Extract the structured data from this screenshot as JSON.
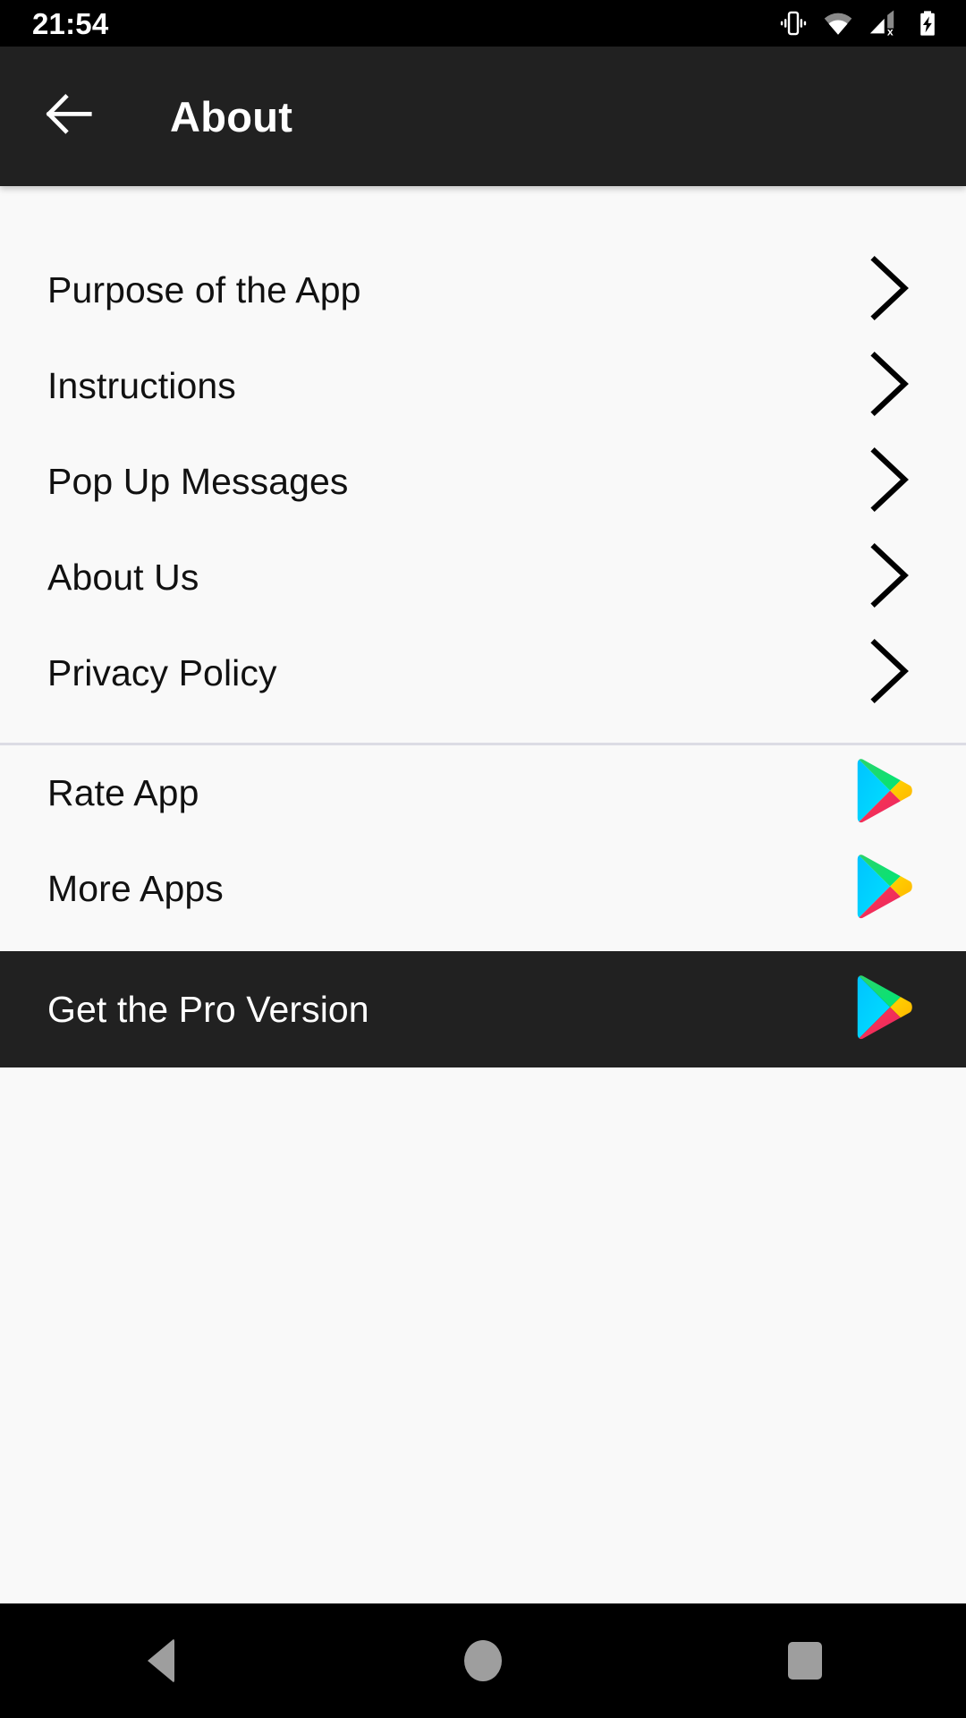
{
  "status_bar": {
    "time": "21:54",
    "icons": [
      {
        "name": "vibrate-icon",
        "label": "Vibrate mode"
      },
      {
        "name": "wifi-icon",
        "label": "Wi-Fi signal"
      },
      {
        "name": "cellular-off-icon",
        "label": "No cellular signal"
      },
      {
        "name": "battery-charging-icon",
        "label": "Battery charging"
      }
    ]
  },
  "app_bar": {
    "title": "About",
    "back_icon": "arrow-left-icon",
    "background": "#212121",
    "text_color": "#ffffff"
  },
  "menu": {
    "groups": [
      {
        "group_name": "info-links",
        "items": [
          {
            "label": "Purpose of the App",
            "icon": "chevron-right-icon",
            "style": "light"
          },
          {
            "label": "Instructions",
            "icon": "chevron-right-icon",
            "style": "light"
          },
          {
            "label": "Pop Up Messages",
            "icon": "chevron-right-icon",
            "style": "light"
          },
          {
            "label": "About Us",
            "icon": "chevron-right-icon",
            "style": "light"
          },
          {
            "label": "Privacy Policy",
            "icon": "chevron-right-icon",
            "style": "light"
          }
        ]
      },
      {
        "group_name": "store-links",
        "items": [
          {
            "label": "Rate App",
            "icon": "google-play-icon",
            "style": "light"
          },
          {
            "label": "More Apps",
            "icon": "google-play-icon",
            "style": "light"
          },
          {
            "label": "Get the Pro Version",
            "icon": "google-play-icon",
            "style": "dark"
          }
        ]
      }
    ]
  },
  "nav_bar": {
    "buttons": [
      {
        "name": "nav-back-button",
        "label": "Back"
      },
      {
        "name": "nav-home-button",
        "label": "Home"
      },
      {
        "name": "nav-recents-button",
        "label": "Recents"
      }
    ]
  },
  "colors": {
    "page_background": "#f9f9f9",
    "app_bar": "#212121",
    "dark_row": "#212121",
    "divider": "#dcdce4",
    "text_primary": "#111111",
    "text_on_dark": "#ffffff",
    "status_bar": "#000000",
    "nav_icon": "#9e9e9e",
    "play_blue": "#00d2ff",
    "play_green": "#00e676",
    "play_yellow": "#ffce00",
    "play_red": "#f4364c"
  }
}
